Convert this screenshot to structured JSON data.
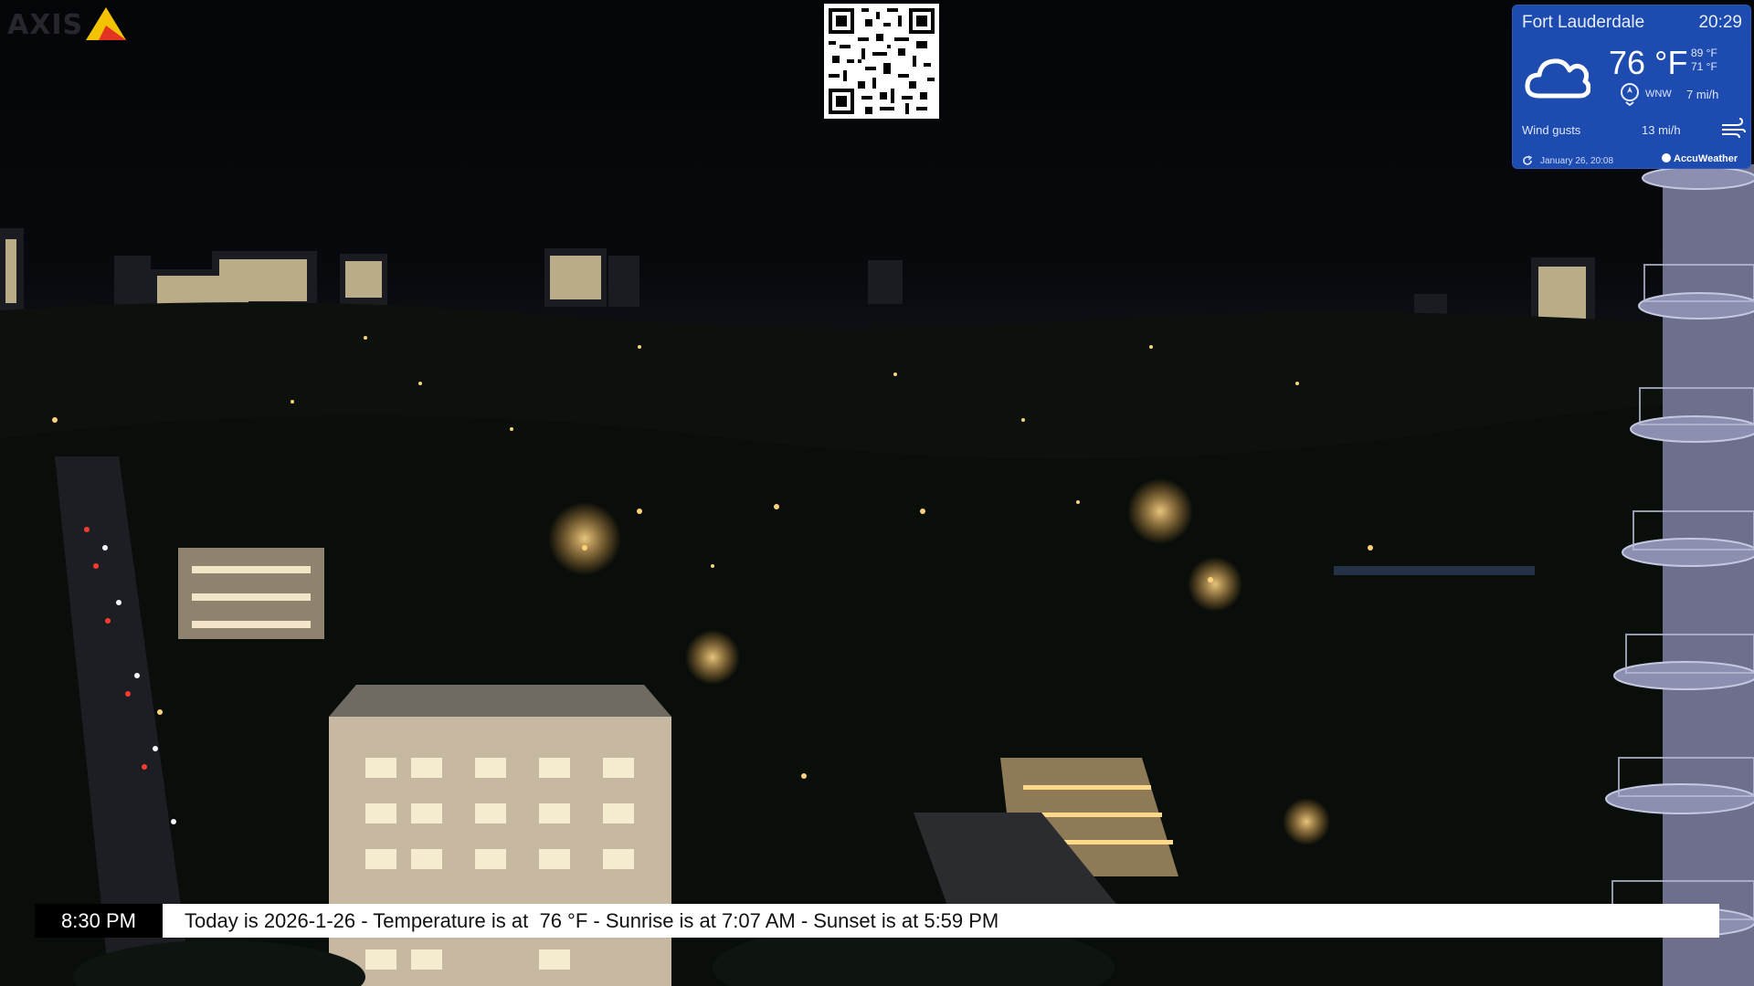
{
  "logo": {
    "text": "AXIS",
    "triangle_colors": [
      "#f3c200",
      "#e53323"
    ]
  },
  "qr_code": {
    "icon": "qr-code-icon"
  },
  "weather": {
    "city": "Fort Lauderdale",
    "time": "20:29",
    "temperature": "76 °F",
    "high": "89 °F",
    "low": "71 °F",
    "wind_direction": "WNW",
    "wind_speed": "7 mi/h",
    "gusts_label": "Wind gusts",
    "gusts_value": "13 mi/h",
    "updated": "January 26, 20:08",
    "provider": "AccuWeather",
    "condition_icon": "partly-cloudy-icon",
    "background_color": "#1d4bb0"
  },
  "ticker": {
    "time": "8:30 PM",
    "message": "Today is 2026-1-26 - Temperature is at  76 °F - Sunrise is at 7:07 AM - Sunset is at 5:59 PM"
  }
}
